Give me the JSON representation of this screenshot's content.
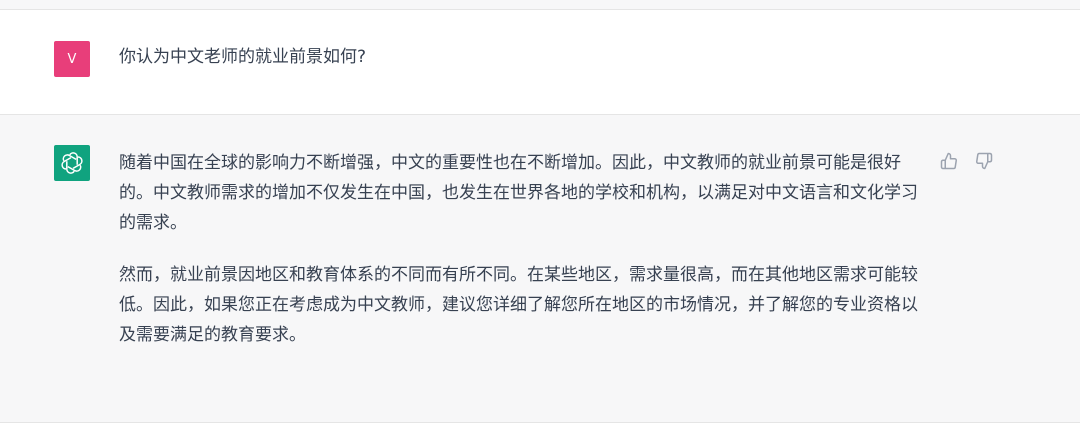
{
  "user_message": {
    "avatar_initial": "V",
    "text": "你认为中文老师的就业前景如何?"
  },
  "assistant_message": {
    "paragraphs": [
      "随着中国在全球的影响力不断增强，中文的重要性也在不断增加。因此，中文教师的就业前景可能是很好的。中文教师需求的增加不仅发生在中国，也发生在世界各地的学校和机构，以满足对中文语言和文化学习的需求。",
      "然而，就业前景因地区和教育体系的不同而有所不同。在某些地区，需求量很高，而在其他地区需求可能较低。因此，如果您正在考虑成为中文教师，建议您详细了解您所在地区的市场情况，并了解您的专业资格以及需要满足的教育要求。"
    ],
    "icons": {
      "avatar": "openai-logo-icon",
      "thumb_up": "thumbs-up-icon",
      "thumb_down": "thumbs-down-icon"
    }
  },
  "colors": {
    "user_avatar": "#e83e7a",
    "bot_avatar": "#10a37f",
    "assistant_bg": "#f7f7f8",
    "text": "#374151",
    "icon": "#9ca3af"
  }
}
